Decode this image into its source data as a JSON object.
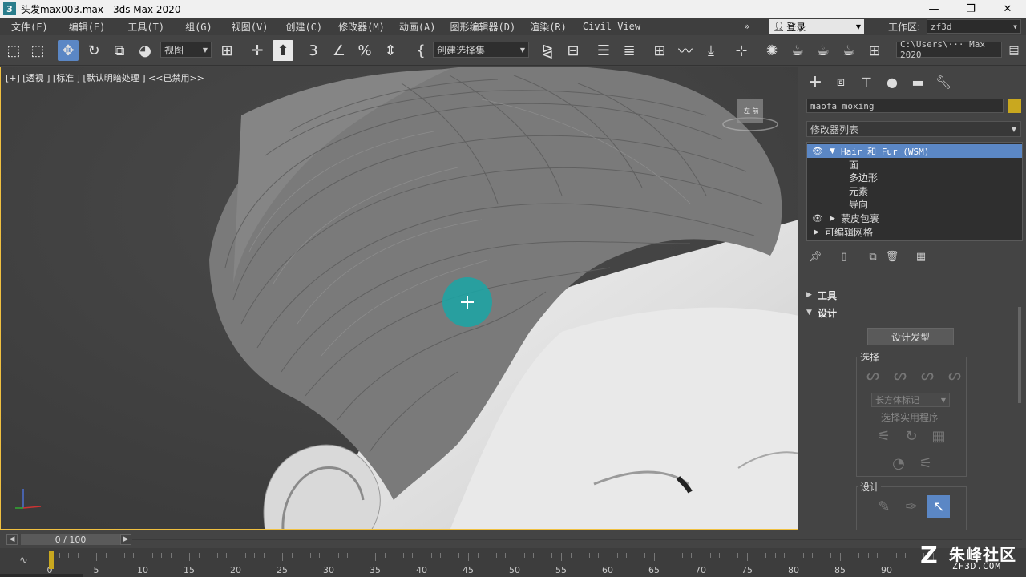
{
  "window": {
    "title": "头发max003.max - 3ds Max 2020",
    "minimize": "—",
    "maximize": "❐",
    "close": "✕"
  },
  "menu": {
    "items": [
      "文件(F)",
      "编辑(E)",
      "工具(T)",
      "组(G)",
      "视图(V)",
      "创建(C)",
      "修改器(M)",
      "动画(A)",
      "图形编辑器(D)",
      "渲染(R)",
      "Civil View"
    ],
    "more": "»",
    "login": "登录",
    "workspace_label": "工作区:",
    "workspace_value": "zf3d"
  },
  "toolbar": {
    "ref_coord": "视图",
    "selection_set": "创建选择集",
    "project_path": "C:\\Users\\··· Max 2020"
  },
  "viewport": {
    "label": "[+] [透视 ] [标准 ] [默认明暗处理 ] <<已禁用>>",
    "cube_label": "左 前"
  },
  "command_panel": {
    "object_name": "maofa_moxing",
    "object_color": "#c9a81f",
    "modifier_list": "修改器列表",
    "stack": [
      {
        "label": "Hair 和 Fur (WSM)",
        "selected": true,
        "expanded": true
      },
      {
        "label": "面",
        "sub": true
      },
      {
        "label": "多边形",
        "sub": true
      },
      {
        "label": "元素",
        "sub": true
      },
      {
        "label": "导向",
        "sub": true
      },
      {
        "label": "蒙皮包裹",
        "selected": false
      },
      {
        "label": "可编辑网格",
        "selected": false
      }
    ],
    "rollouts": {
      "tools": "工具",
      "design": "设计"
    },
    "design_button": "设计发型",
    "select_group": {
      "title": "选择",
      "dropdown": "长方体标记",
      "utils_label": "选择实用程序"
    },
    "design_group": {
      "title": "设计"
    }
  },
  "time": {
    "frame_display": "0 / 100",
    "ticks": [
      "0",
      "5",
      "10",
      "15",
      "20",
      "25",
      "30",
      "35",
      "40",
      "45",
      "50",
      "55",
      "60",
      "65",
      "70",
      "75",
      "80",
      "85",
      "90"
    ]
  },
  "watermark": {
    "main": "朱峰社区",
    "sub": "ZF3D.COM"
  }
}
